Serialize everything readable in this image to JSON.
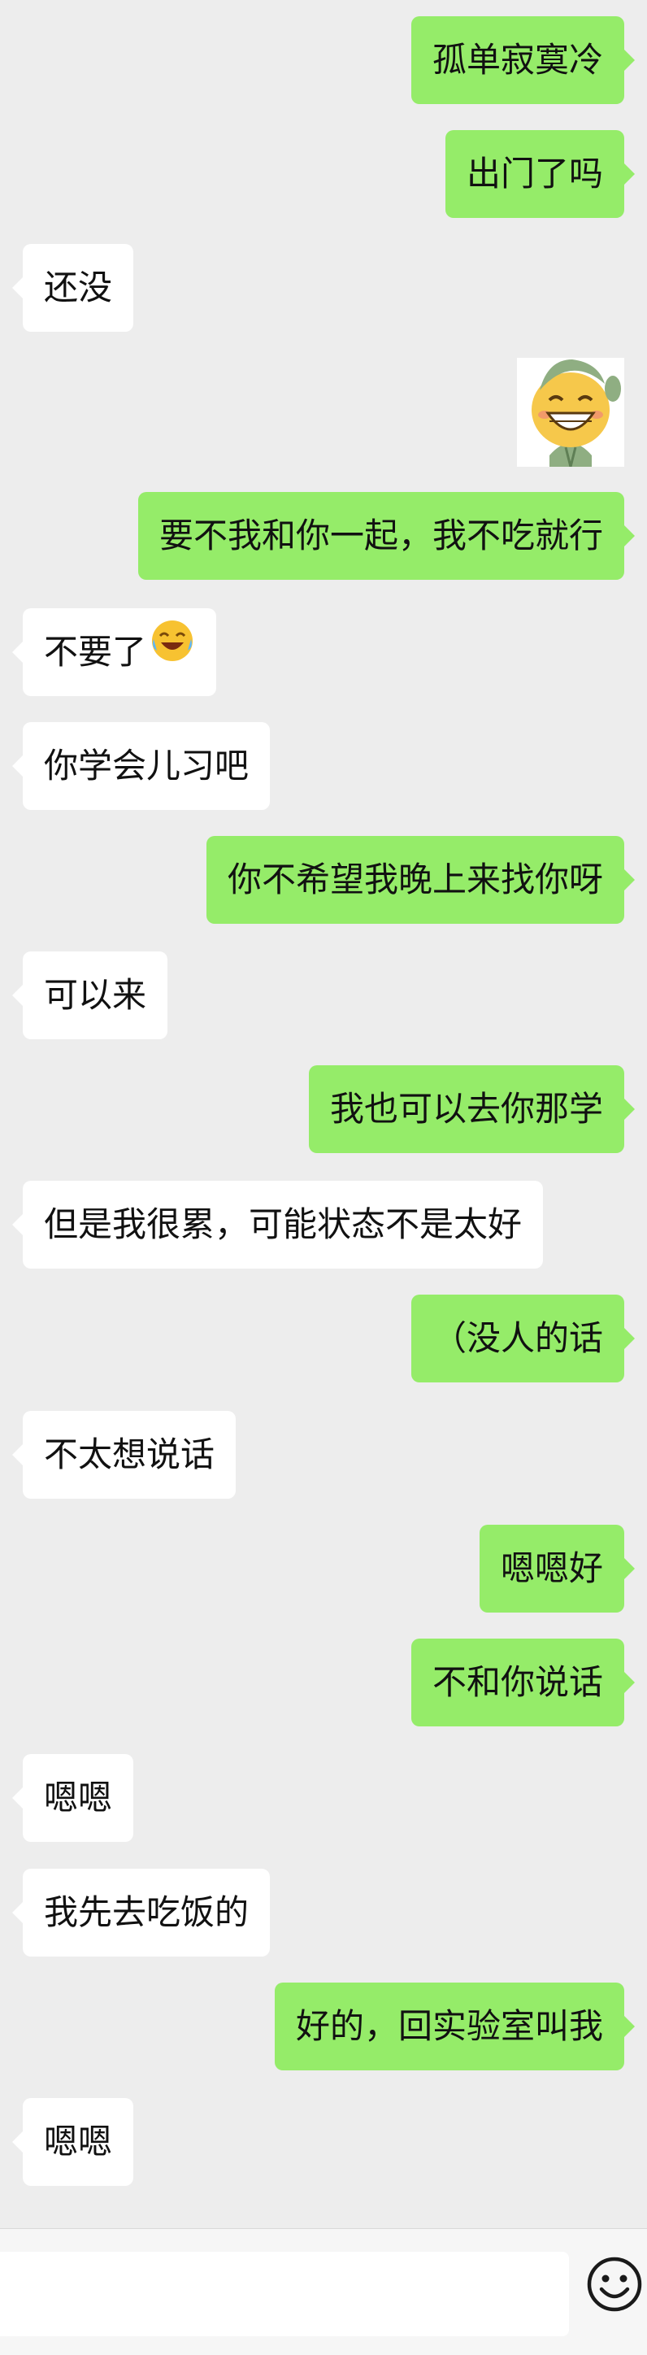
{
  "messages": [
    {
      "side": "right",
      "type": "text",
      "text": "孤单寂寞冷"
    },
    {
      "side": "right",
      "type": "text",
      "text": "出门了吗"
    },
    {
      "side": "left",
      "type": "text",
      "text": "还没"
    },
    {
      "side": "right",
      "type": "sticker",
      "sticker": "grinning-bean-sticker"
    },
    {
      "side": "right",
      "type": "text",
      "text": "要不我和你一起，我不吃就行"
    },
    {
      "side": "left",
      "type": "text",
      "text": "不要了",
      "emoji": "laughing-crying-emoji"
    },
    {
      "side": "left",
      "type": "text",
      "text": "你学会儿习吧"
    },
    {
      "side": "right",
      "type": "text",
      "text": "你不希望我晚上来找你呀"
    },
    {
      "side": "left",
      "type": "text",
      "text": "可以来"
    },
    {
      "side": "right",
      "type": "text",
      "text": "我也可以去你那学"
    },
    {
      "side": "left",
      "type": "text",
      "text": "但是我很累，可能状态不是太好"
    },
    {
      "side": "right",
      "type": "text",
      "text": "（没人的话"
    },
    {
      "side": "left",
      "type": "text",
      "text": "不太想说话"
    },
    {
      "side": "right",
      "type": "text",
      "text": "嗯嗯好"
    },
    {
      "side": "right",
      "type": "text",
      "text": "不和你说话"
    },
    {
      "side": "left",
      "type": "text",
      "text": "嗯嗯"
    },
    {
      "side": "left",
      "type": "text",
      "text": "我先去吃饭的"
    },
    {
      "side": "right",
      "type": "text",
      "text": "好的，回实验室叫我"
    },
    {
      "side": "left",
      "type": "text",
      "text": "嗯嗯"
    }
  ],
  "input_bar": {
    "value": "",
    "emoji_icon": "smiley-face-icon"
  },
  "colors": {
    "outgoing_bubble": "#95ec69",
    "incoming_bubble": "#ffffff",
    "background": "#ededed"
  }
}
